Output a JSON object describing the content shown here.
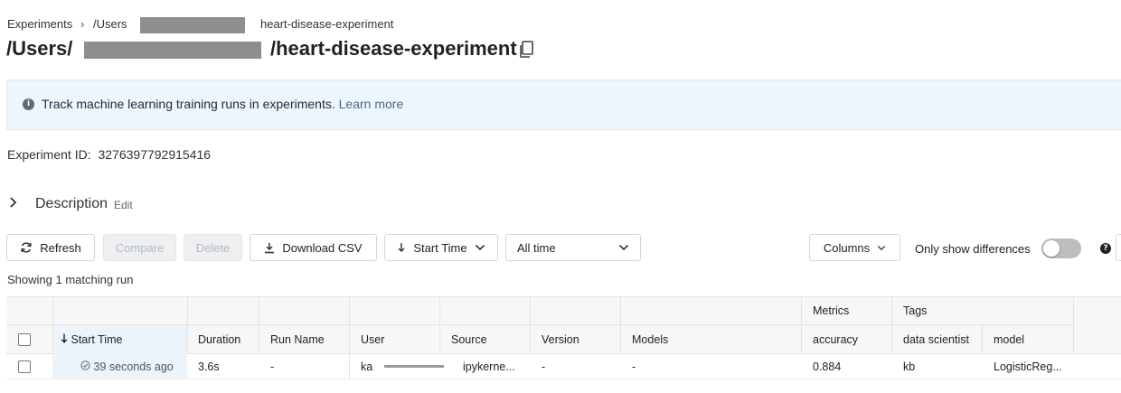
{
  "breadcrumb": {
    "root": "Experiments",
    "separator": "›",
    "users": "/Users",
    "experiment": "heart-disease-experiment"
  },
  "title": {
    "prefix": "/Users/",
    "suffix": "/heart-disease-experiment"
  },
  "banner": {
    "icon": "info-icon",
    "text": "Track machine learning training runs in experiments.",
    "link": "Learn more"
  },
  "experiment_id": {
    "label": "Experiment ID:",
    "value": "3276397792915416"
  },
  "description": {
    "label": "Description",
    "edit": "Edit"
  },
  "toolbar": {
    "refresh": "Refresh",
    "compare": "Compare",
    "delete": "Delete",
    "download": "Download CSV",
    "sort": "Start Time",
    "time_range": "All time",
    "columns": "Columns",
    "only_diff": "Only show differences",
    "help": "?"
  },
  "status": "Showing 1 matching run",
  "table": {
    "group_headers": {
      "metrics": "Metrics",
      "tags": "Tags"
    },
    "columns": {
      "start_time": "Start Time",
      "duration": "Duration",
      "run_name": "Run Name",
      "user": "User",
      "source": "Source",
      "version": "Version",
      "models": "Models",
      "accuracy": "accuracy",
      "data_scientist": "data scientist",
      "model": "model"
    },
    "rows": [
      {
        "start_time": "39 seconds ago",
        "duration": "3.6s",
        "run_name": "-",
        "user": "ka",
        "source": "ipykerne...",
        "version": "-",
        "models": "-",
        "accuracy": "0.884",
        "data_scientist": "kb",
        "model": "LogisticReg..."
      }
    ]
  },
  "colors": {
    "banner_bg": "#ecf6fc",
    "link": "#4d6a80",
    "selected_column": "#ecf4fb"
  }
}
